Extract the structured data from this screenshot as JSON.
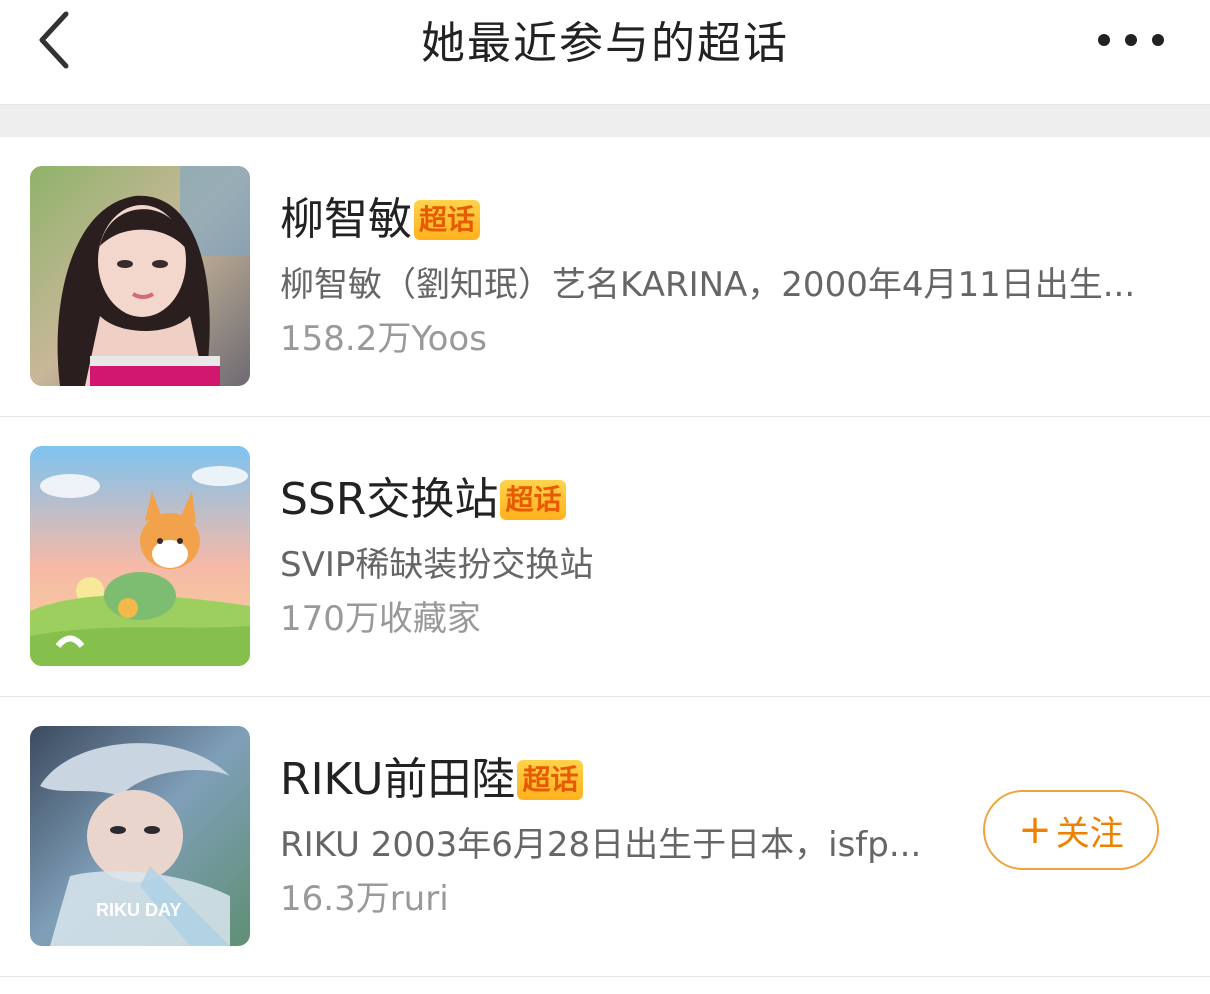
{
  "header": {
    "title": "她最近参与的超话",
    "back_icon": "chevron-left-icon",
    "more_icon": "more-horizontal-icon"
  },
  "topics": [
    {
      "name": "柳智敏",
      "badge": "超话",
      "description": "柳智敏（劉知珉）艺名KARINA，2000年4月11日出生...",
      "stat": "158.2万Yoos",
      "avatar": "portrait-photo"
    },
    {
      "name": "SSR交换站",
      "badge": "超话",
      "description": "SVIP稀缺装扮交换站",
      "stat": "170万收藏家",
      "avatar": "corgi-illustration"
    },
    {
      "name": "RIKU前田陸",
      "badge": "超话",
      "description": "RIKU 2003年6月28日出生于日本，isfp...",
      "stat": "16.3万ruri",
      "avatar": "portrait-photo",
      "avatar_text": "RIKU DAY",
      "follow_plus": "+",
      "follow_label": "关注"
    }
  ],
  "colors": {
    "accent": "#f08000",
    "badge_bg": "#ffc12e",
    "badge_text": "#e85a00",
    "secondary_text": "#666666",
    "stat_text": "#999999"
  }
}
